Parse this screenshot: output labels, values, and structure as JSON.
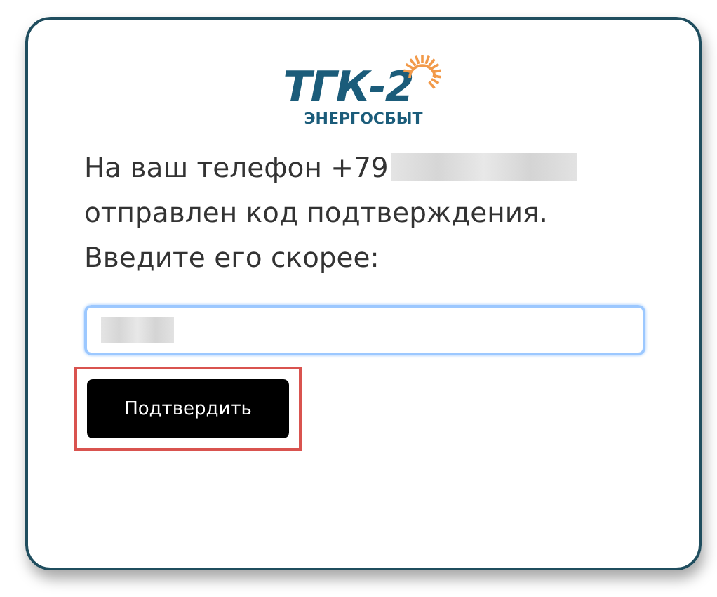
{
  "logo": {
    "mark": "ТГК-2",
    "subtitle": "ЭНЕРГОСБЫТ"
  },
  "message": {
    "lines": [
      "На ваш телефон +79",
      "отправлен код подтверждения.",
      "Введите его скорее:"
    ],
    "phone_redacted": true
  },
  "code_field": {
    "value_redacted": true,
    "focused": true
  },
  "confirm_button": {
    "label": "Подтвердить",
    "highlighted": true
  }
}
